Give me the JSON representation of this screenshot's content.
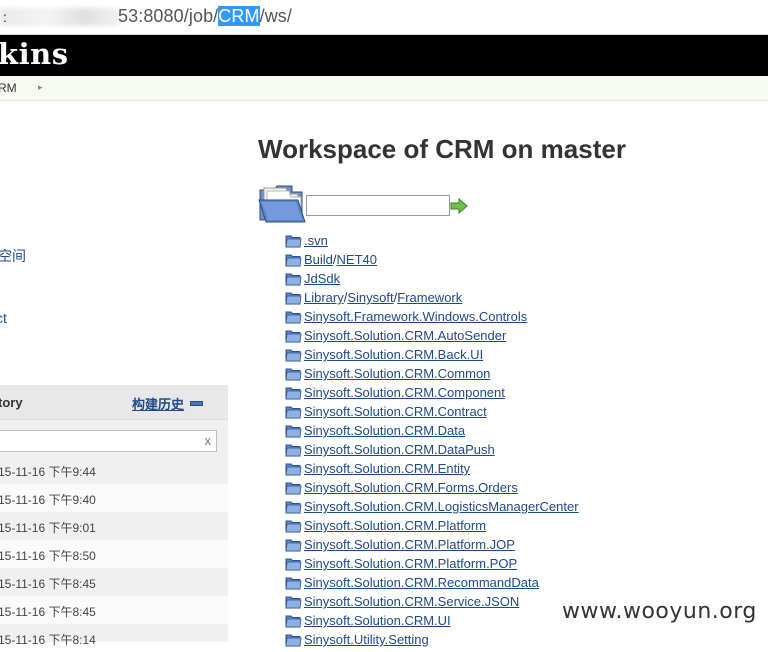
{
  "address_bar": {
    "leading": ":",
    "prefix": "53:8080/job/",
    "selected": "CRM",
    "suffix": "/ws/"
  },
  "header": {
    "logo_text": "kins"
  },
  "breadcrumb": {
    "item": "RM"
  },
  "sidebar": {
    "links": [
      {
        "label": "空间"
      },
      {
        "label": "ct"
      }
    ]
  },
  "build_history": {
    "title": "tory",
    "trend_label": "构建历史",
    "filter_clear": "x",
    "rows": [
      "15-11-16 下午9:44",
      "15-11-16 下午9:40",
      "15-11-16 下午9:01",
      "15-11-16 下午8:50",
      "15-11-16 下午8:45",
      "15-11-16 下午8:45",
      "15-11-16 下午8:14"
    ]
  },
  "main": {
    "title": "Workspace of CRM on master",
    "path_input_value": "",
    "entries": [
      [
        ".svn"
      ],
      [
        "Build",
        "NET40"
      ],
      [
        "JdSdk"
      ],
      [
        "Library",
        "Sinysoft",
        "Framework"
      ],
      [
        "Sinysoft.Framework.Windows.Controls"
      ],
      [
        "Sinysoft.Solution.CRM.AutoSender"
      ],
      [
        "Sinysoft.Solution.CRM.Back.UI"
      ],
      [
        "Sinysoft.Solution.CRM.Common"
      ],
      [
        "Sinysoft.Solution.CRM.Component"
      ],
      [
        "Sinysoft.Solution.CRM.Contract"
      ],
      [
        "Sinysoft.Solution.CRM.Data"
      ],
      [
        "Sinysoft.Solution.CRM.DataPush"
      ],
      [
        "Sinysoft.Solution.CRM.Entity"
      ],
      [
        "Sinysoft.Solution.CRM.Forms.Orders"
      ],
      [
        "Sinysoft.Solution.CRM.LogisticsManagerCenter"
      ],
      [
        "Sinysoft.Solution.CRM.Platform"
      ],
      [
        "Sinysoft.Solution.CRM.Platform.JOP"
      ],
      [
        "Sinysoft.Solution.CRM.Platform.POP"
      ],
      [
        "Sinysoft.Solution.CRM.RecommandData"
      ],
      [
        "Sinysoft.Solution.CRM.Service.JSON"
      ],
      [
        "Sinysoft.Solution.CRM.UI"
      ],
      [
        "Sinysoft.Utility.Setting"
      ]
    ]
  },
  "watermark": "www.wooyun.org",
  "colors": {
    "header_bg": "#000000",
    "link": "#204a87",
    "selection": "#3399ff",
    "folder": "#7aa0d8"
  },
  "icons": {
    "folder": "folder-icon",
    "go": "go-arrow-icon",
    "collapse": "collapse-icon"
  }
}
